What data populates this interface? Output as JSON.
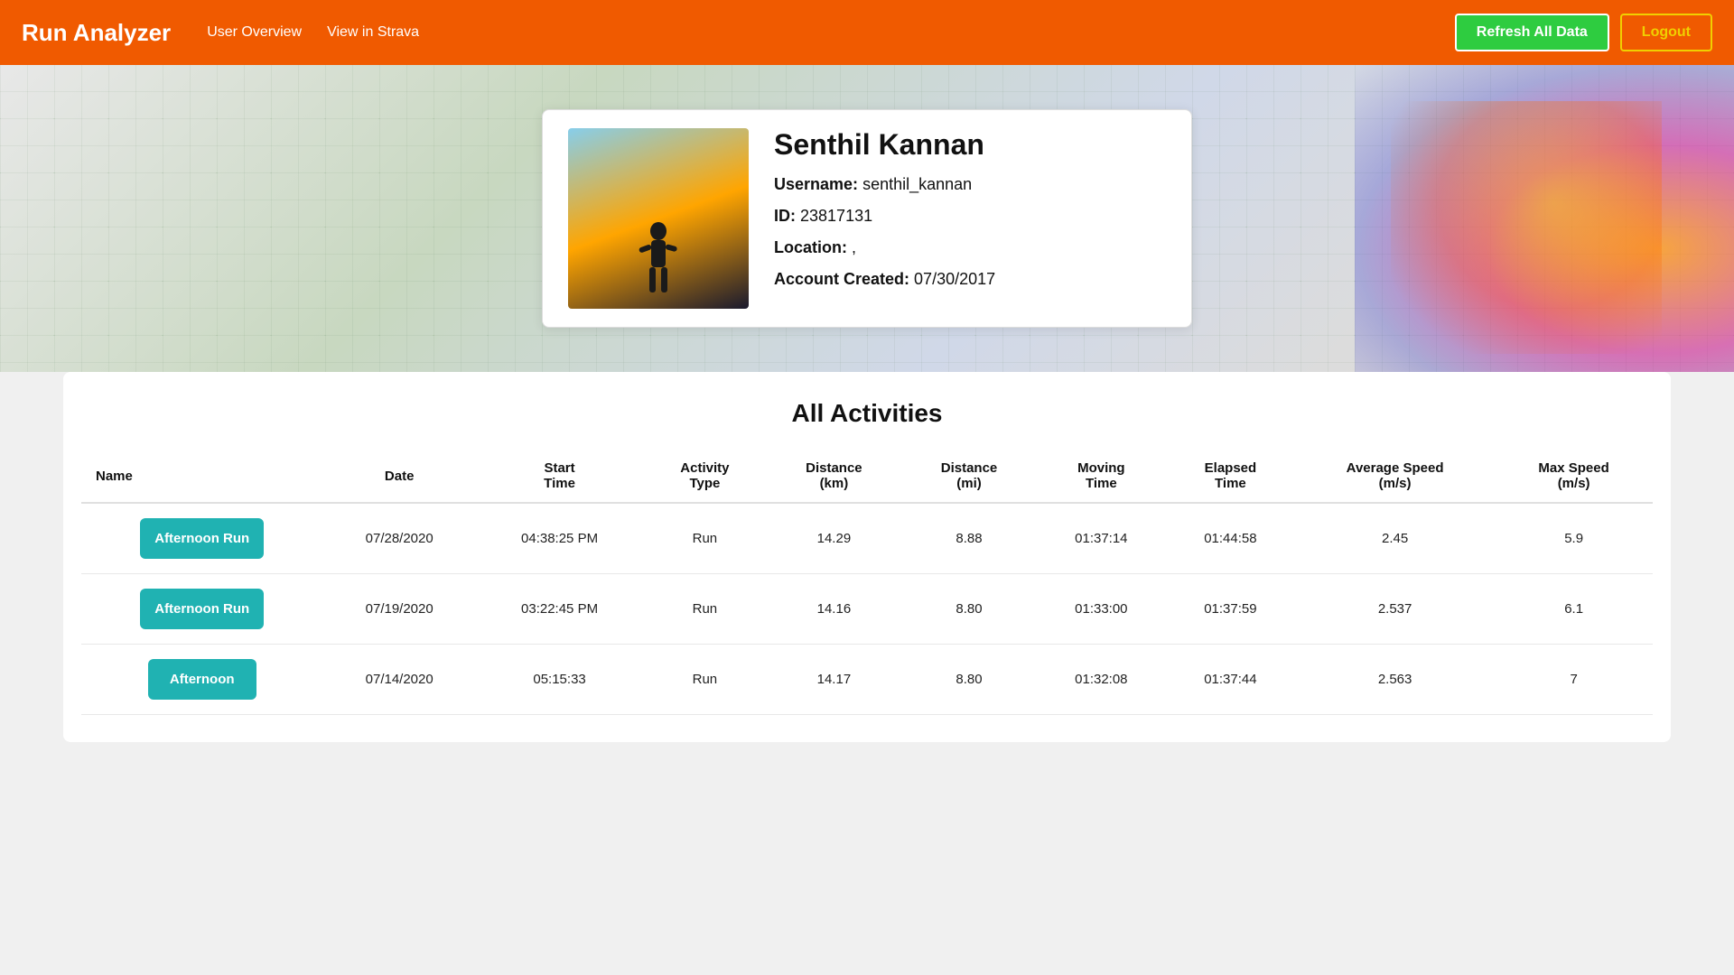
{
  "app": {
    "title": "Run Analyzer"
  },
  "navbar": {
    "brand": "Run Analyzer",
    "links": [
      {
        "label": "User Overview",
        "name": "user-overview-link"
      },
      {
        "label": "View in Strava",
        "name": "view-in-strava-link"
      }
    ],
    "refresh_label": "Refresh All Data",
    "logout_label": "Logout"
  },
  "profile": {
    "name": "Senthil Kannan",
    "username_label": "Username:",
    "username_value": "senthil_kannan",
    "id_label": "ID:",
    "id_value": "23817131",
    "location_label": "Location:",
    "location_value": ",",
    "account_created_label": "Account Created:",
    "account_created_value": "07/30/2017"
  },
  "activities": {
    "section_title": "All Activities",
    "columns": [
      {
        "key": "name",
        "label": "Name"
      },
      {
        "key": "date",
        "label": "Date"
      },
      {
        "key": "start_time",
        "label": "Start Time"
      },
      {
        "key": "activity_type",
        "label": "Activity Type"
      },
      {
        "key": "distance_km",
        "label": "Distance (km)"
      },
      {
        "key": "distance_mi",
        "label": "Distance (mi)"
      },
      {
        "key": "moving_time",
        "label": "Moving Time"
      },
      {
        "key": "elapsed_time",
        "label": "Elapsed Time"
      },
      {
        "key": "avg_speed",
        "label": "Average Speed (m/s)"
      },
      {
        "key": "max_speed",
        "label": "Max Speed (m/s)"
      }
    ],
    "rows": [
      {
        "name": "Afternoon Run",
        "date": "07/28/2020",
        "start_time": "04:38:25 PM",
        "activity_type": "Run",
        "distance_km": "14.29",
        "distance_mi": "8.88",
        "moving_time": "01:37:14",
        "elapsed_time": "01:44:58",
        "avg_speed": "2.45",
        "max_speed": "5.9"
      },
      {
        "name": "Afternoon Run",
        "date": "07/19/2020",
        "start_time": "03:22:45 PM",
        "activity_type": "Run",
        "distance_km": "14.16",
        "distance_mi": "8.80",
        "moving_time": "01:33:00",
        "elapsed_time": "01:37:59",
        "avg_speed": "2.537",
        "max_speed": "6.1"
      },
      {
        "name": "Afternoon",
        "date": "07/14/2020",
        "start_time": "05:15:33",
        "activity_type": "Run",
        "distance_km": "14.17",
        "distance_mi": "8.80",
        "moving_time": "01:32:08",
        "elapsed_time": "01:37:44",
        "avg_speed": "2.563",
        "max_speed": "7"
      }
    ]
  }
}
